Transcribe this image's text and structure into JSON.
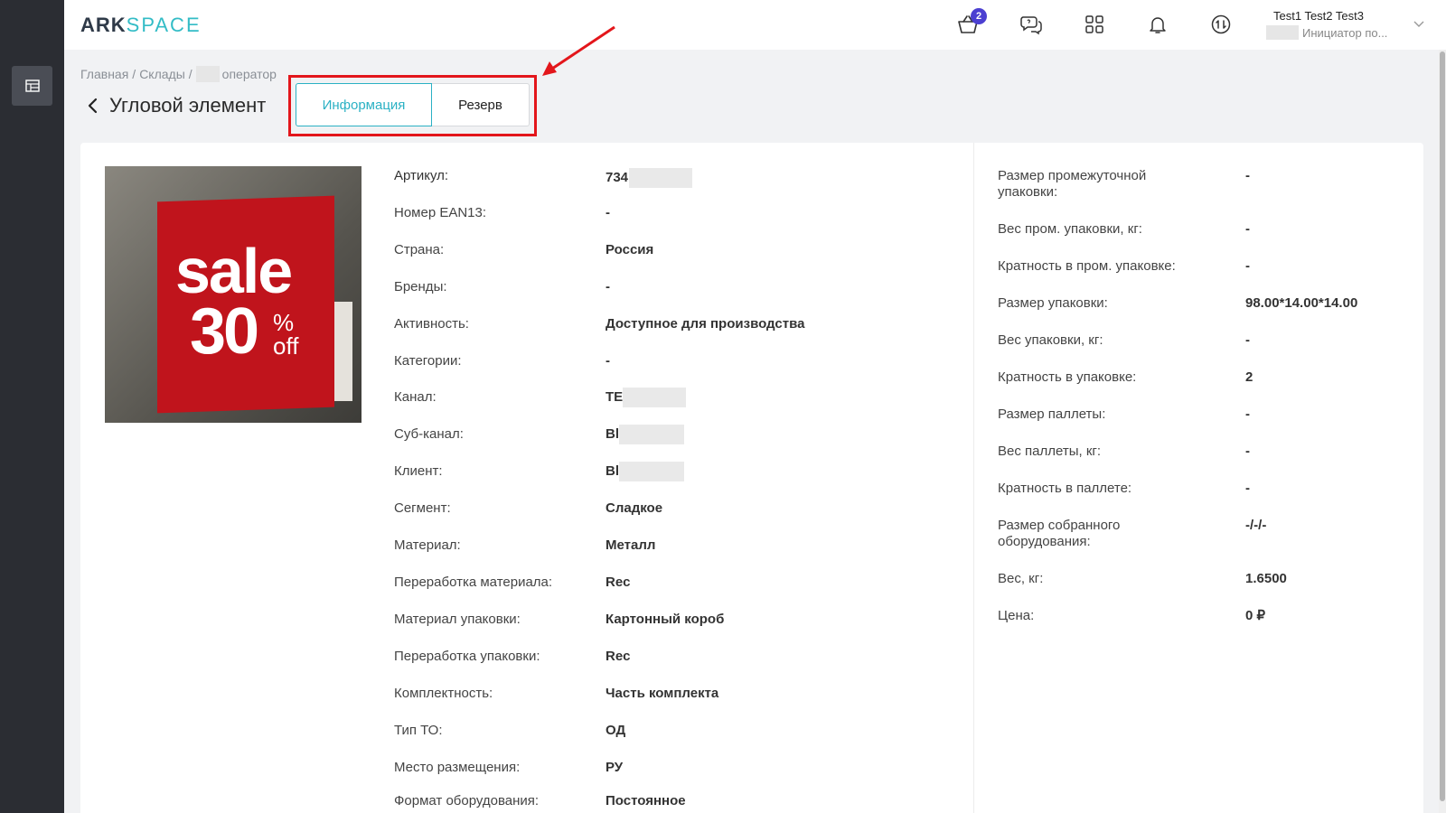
{
  "app": {
    "logo_part1": "ARK",
    "logo_part2": "SPACE"
  },
  "header": {
    "cart_count": "2",
    "user_name": "Test1 Test2 Test3",
    "user_role": "Инициатор по..."
  },
  "breadcrumb": {
    "home": "Главная",
    "warehouses": "Склады",
    "current": "оператор",
    "separator": "/"
  },
  "page": {
    "title": "Угловой элемент",
    "tabs": [
      {
        "label": "Информация",
        "active": true
      },
      {
        "label": "Резерв",
        "active": false
      }
    ]
  },
  "product": {
    "image_text": {
      "line1": "sale",
      "line2": "30",
      "pct": "%",
      "off": "off"
    },
    "left_fields": [
      {
        "label": "Артикул:",
        "value": "734"
      },
      {
        "label": "Номер EAN13:",
        "value": "-"
      },
      {
        "label": "Страна:",
        "value": "Россия"
      },
      {
        "label": "Бренды:",
        "value": "-"
      },
      {
        "label": "Активность:",
        "value": "Доступное для производства"
      },
      {
        "label": "Категории:",
        "value": "-"
      },
      {
        "label": "Канал:",
        "value": "TE"
      },
      {
        "label": "Суб-канал:",
        "value": "Bl"
      },
      {
        "label": "Клиент:",
        "value": "Bl"
      },
      {
        "label": "Сегмент:",
        "value": "Сладкое"
      },
      {
        "label": "Материал:",
        "value": "Металл"
      },
      {
        "label": "Переработка материала:",
        "value": "Rec"
      },
      {
        "label": "Материал упаковки:",
        "value": "Картонный короб"
      },
      {
        "label": "Переработка упаковки:",
        "value": "Rec"
      },
      {
        "label": "Комплектность:",
        "value": "Часть комплекта"
      },
      {
        "label": "Тип ТО:",
        "value": "ОД"
      },
      {
        "label": "Место размещения:",
        "value": "РУ"
      },
      {
        "label": "Формат оборудования:",
        "value": "Постоянное"
      }
    ],
    "right_fields": [
      {
        "label_1": "Размер промежуточной",
        "label_2": "упаковки:",
        "value": "-"
      },
      {
        "label": "Вес пром. упаковки, кг:",
        "value": "-"
      },
      {
        "label": "Кратность в пром. упаковке:",
        "value": "-"
      },
      {
        "label": "Размер упаковки:",
        "value": "98.00*14.00*14.00"
      },
      {
        "label": "Вес упаковки, кг:",
        "value": "-"
      },
      {
        "label": "Кратность в упаковке:",
        "value": "2"
      },
      {
        "label": "Размер паллеты:",
        "value": "-"
      },
      {
        "label": "Вес паллеты, кг:",
        "value": "-"
      },
      {
        "label": "Кратность в паллете:",
        "value": "-"
      },
      {
        "label_1": "Размер собранного",
        "label_2": "оборудования:",
        "value": "-/-/-"
      },
      {
        "label": "Вес, кг:",
        "value": "1.6500"
      },
      {
        "label": "Цена:",
        "value": "0 ₽"
      }
    ]
  },
  "colors": {
    "accent": "#2bb1c4",
    "highlight": "#e3161b",
    "badge": "#4b3fd1",
    "rail": "#2b2d33"
  }
}
